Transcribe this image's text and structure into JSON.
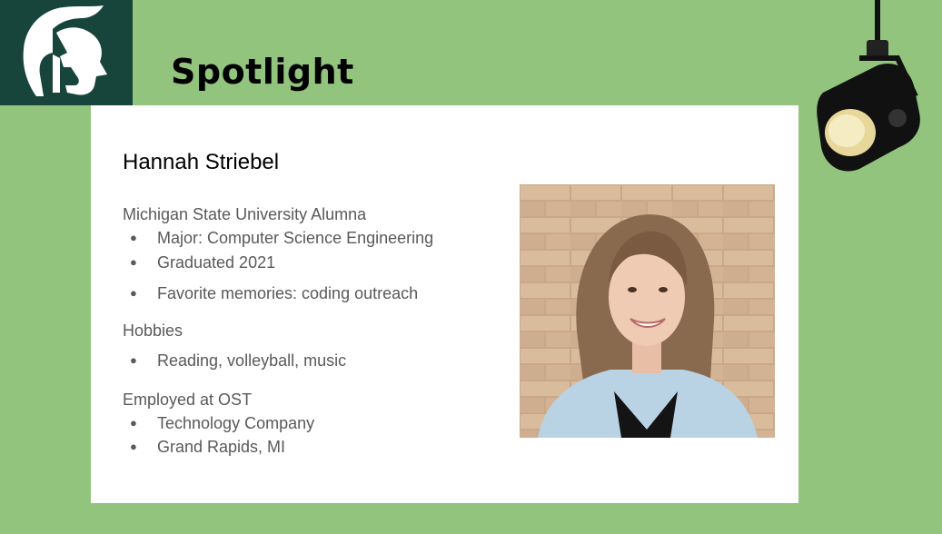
{
  "slide": {
    "title": "Spotlight",
    "logo_icon": "spartan-helmet-icon",
    "decor_icon": "stage-spotlight-icon",
    "colors": {
      "background": "#93c47d",
      "logo_bg": "#18453b",
      "card": "#ffffff",
      "text_muted": "#595959"
    }
  },
  "profile": {
    "name": "Hannah Striebel",
    "sections": [
      {
        "heading": "Michigan State University Alumna",
        "bullets": [
          "Major: Computer Science Engineering",
          "Graduated 2021",
          "Favorite memories: coding outreach"
        ]
      },
      {
        "heading": "Hobbies",
        "bullets": [
          "Reading, volleyball, music"
        ]
      },
      {
        "heading": "Employed at OST",
        "bullets": [
          "Technology Company",
          "Grand Rapids, MI"
        ]
      }
    ],
    "bullet_glyph": "●",
    "photo_icon": "portrait-photo"
  }
}
